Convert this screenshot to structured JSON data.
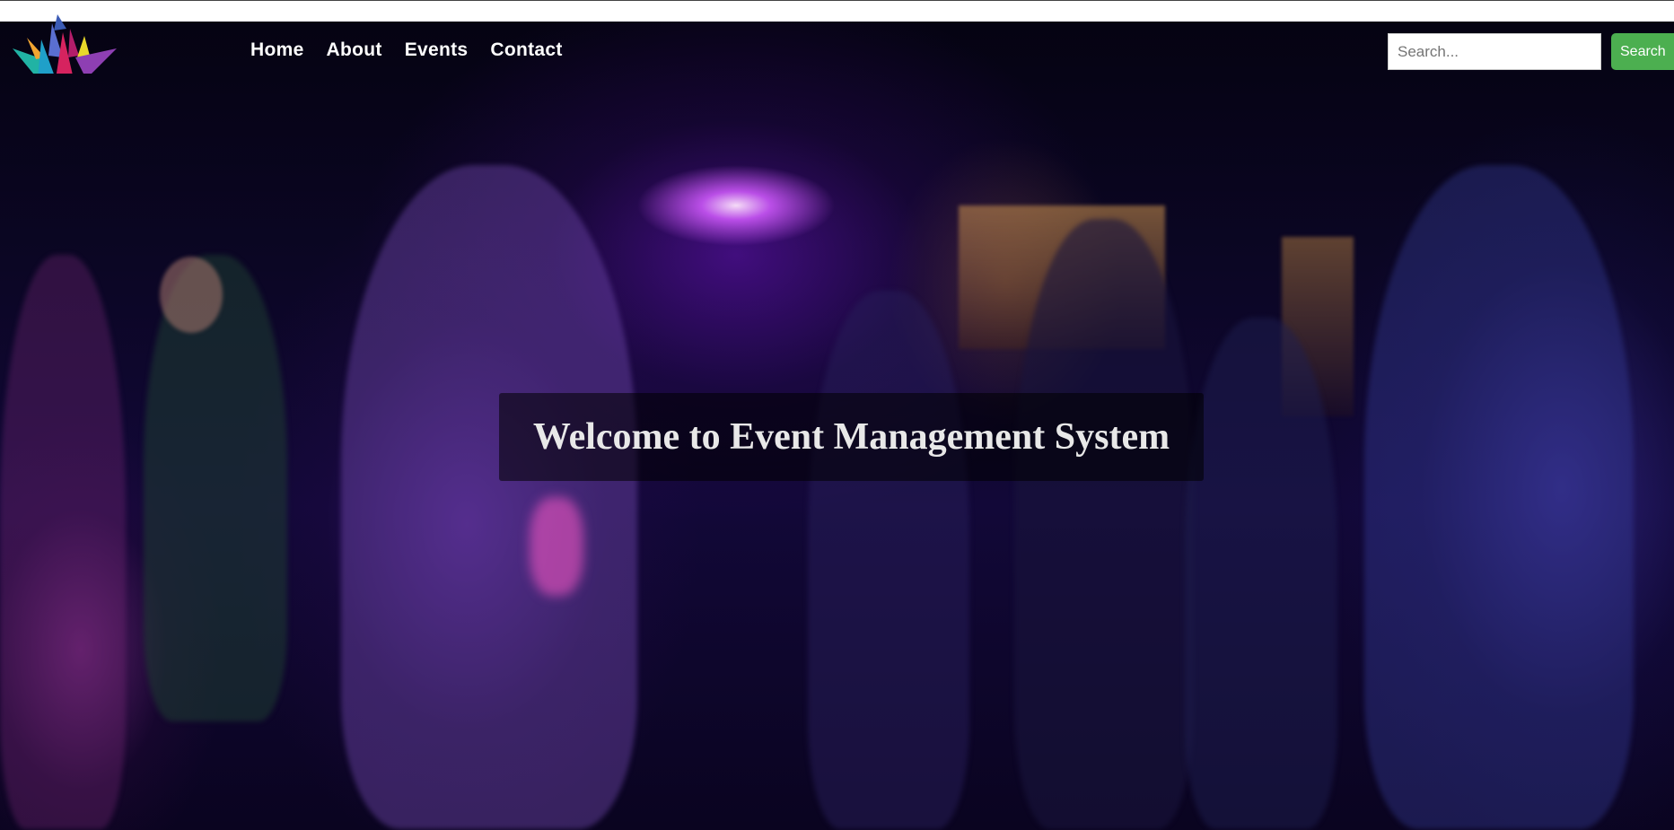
{
  "nav": {
    "logo_icon": "colorful-spiky-logo-icon",
    "links": [
      {
        "label": "Home"
      },
      {
        "label": "About"
      },
      {
        "label": "Events"
      },
      {
        "label": "Contact"
      }
    ]
  },
  "search": {
    "placeholder": "Search...",
    "value": "",
    "button_label": "Search"
  },
  "hero": {
    "title": "Welcome to Event Management System",
    "background": "nightclub-crowd-photo"
  },
  "colors": {
    "search_button": "#4caf50",
    "nav_text": "#ffffff",
    "title_text": "#e8e8e8"
  }
}
